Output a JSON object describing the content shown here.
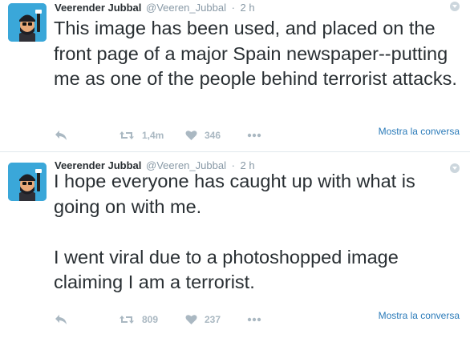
{
  "tweets": [
    {
      "fullname": "Veerender Jubbal",
      "username": "@Veeren_Jubbal",
      "separator": "·",
      "time": "2 h",
      "text": "This image has been used, and placed on the front page of a major Spain newspaper--putting me as one of the people behind terrorist attacks.",
      "retweets": "1,4m",
      "likes": "346",
      "conversation_link": "Mostra la conversa"
    },
    {
      "fullname": "Veerender Jubbal",
      "username": "@Veeren_Jubbal",
      "separator": "·",
      "time": "2 h",
      "text": "I hope everyone has caught up with what is going on with me.\n\nI went viral due to a photoshopped image claiming I am a terrorist.",
      "retweets": "809",
      "likes": "237",
      "conversation_link": "Mostra la conversa"
    }
  ],
  "icons": {
    "avatar": "avatar-illustration",
    "caret": "dropdown-caret-icon",
    "reply": "reply-icon",
    "retweet": "retweet-icon",
    "like": "heart-icon",
    "more": "more-dots-icon"
  },
  "colors": {
    "text": "#292f33",
    "muted": "#8899a6",
    "action_icon": "#aab8c2",
    "link": "#2b7bb9",
    "avatar_bg": "#3aa7d9"
  }
}
